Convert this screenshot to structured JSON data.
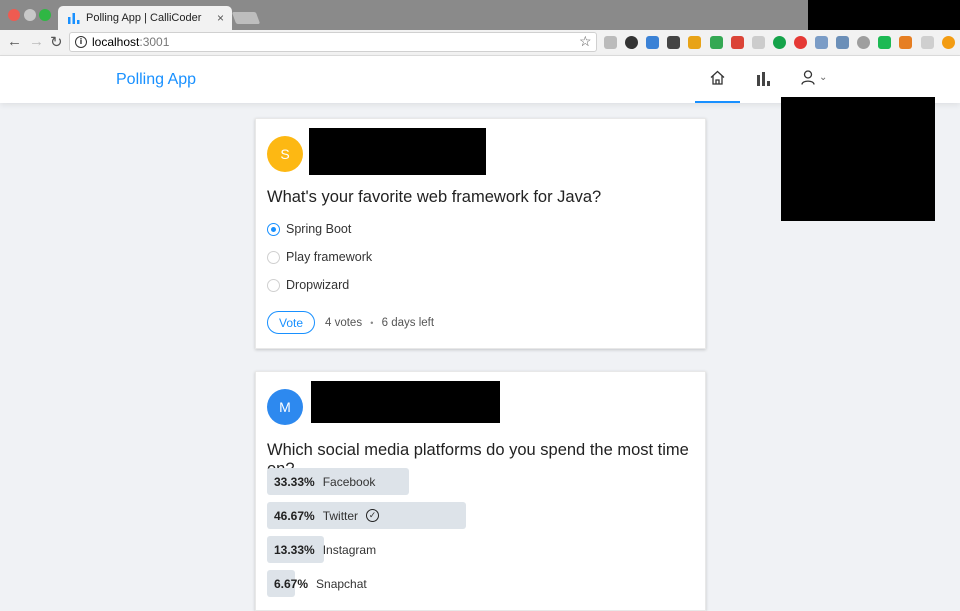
{
  "browser": {
    "tab_title": "Polling App | CalliCoder",
    "tab_close": "×",
    "url_host": "localhost",
    "url_port": ":3001",
    "back": "←",
    "forward": "→",
    "reload": "↻",
    "bookmark": "☆",
    "extension_colors": [
      "#bbbbbb",
      "#333333",
      "#3b82d6",
      "#444444",
      "#e8a317",
      "#34a853",
      "#db4437",
      "#cccccc",
      "#15a34a",
      "#e53935",
      "#7a9cc6",
      "#6b8fb8",
      "#9e9e9e",
      "#1db954",
      "#e67e22",
      "#cfcfcf",
      "#f39c12"
    ]
  },
  "app": {
    "logo": "Polling App",
    "brand_color": "#1890ff",
    "nav": {
      "home_icon": "⌂",
      "polls_icon": "chart",
      "profile_icon": "user",
      "chevron": "⌄"
    }
  },
  "polls": [
    {
      "avatar_letter": "S",
      "avatar_color": "#fdb813",
      "question": "What's your favorite web framework for Java?",
      "choices": [
        {
          "label": "Spring Boot",
          "selected": true
        },
        {
          "label": "Play framework",
          "selected": false
        },
        {
          "label": "Dropwizard",
          "selected": false
        }
      ],
      "vote_label": "Vote",
      "votes": "4 votes",
      "separator": "•",
      "time_left": "6 days left"
    },
    {
      "avatar_letter": "M",
      "avatar_color": "#2d89ef",
      "question": "Which social media platforms do you spend the most time on?",
      "results": [
        {
          "percent": "33.33%",
          "value": 33.33,
          "label": "Facebook",
          "winner": false
        },
        {
          "percent": "46.67%",
          "value": 46.67,
          "label": "Twitter",
          "winner": true,
          "check": "✓"
        },
        {
          "percent": "13.33%",
          "value": 13.33,
          "label": "Instagram",
          "winner": false
        },
        {
          "percent": "6.67%",
          "value": 6.67,
          "label": "Snapchat",
          "winner": false
        }
      ]
    }
  ]
}
